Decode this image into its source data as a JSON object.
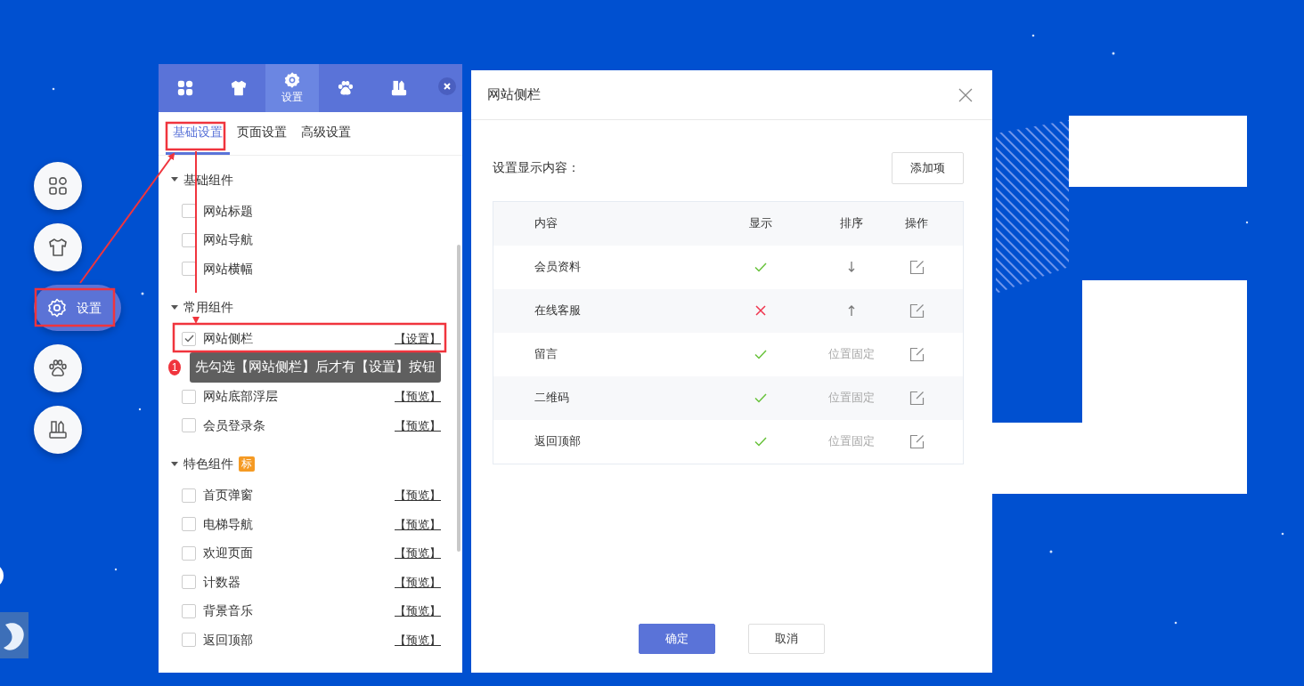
{
  "side_nav": [
    {
      "selected": false
    },
    {
      "selected": false
    },
    {
      "label": "设置",
      "selected": true
    },
    {
      "selected": false
    },
    {
      "selected": false
    }
  ],
  "panel": {
    "tabs": [
      {
        "selected": false
      },
      {
        "selected": false
      },
      {
        "label": "设置",
        "selected": true
      },
      {
        "selected": false
      },
      {
        "selected": false
      }
    ],
    "subtabs": [
      {
        "label": "基础设置",
        "selected": true
      },
      {
        "label": "页面设置",
        "selected": false
      },
      {
        "label": "高级设置",
        "selected": false
      }
    ],
    "groups": [
      {
        "title": "基础组件",
        "expanded": true,
        "items": [
          {
            "label": "网站标题",
            "checked": false
          },
          {
            "label": "网站导航",
            "checked": false
          },
          {
            "label": "网站横幅",
            "checked": false
          }
        ]
      },
      {
        "title": "常用组件",
        "expanded": true,
        "items": [
          {
            "kind": "item",
            "label": "网站侧栏",
            "checked": true,
            "action": "【设置】"
          },
          {
            "kind": "covered"
          },
          {
            "kind": "item",
            "label": "网站底部浮层",
            "checked": false,
            "action": "【预览】"
          },
          {
            "kind": "item",
            "label": "会员登录条",
            "checked": false,
            "action": "【预览】"
          }
        ]
      },
      {
        "title": "特色组件",
        "badge": "标",
        "expanded": true,
        "items": [
          {
            "label": "首页弹窗",
            "checked": false,
            "action": "【预览】"
          },
          {
            "label": "电梯导航",
            "checked": false,
            "action": "【预览】"
          },
          {
            "label": "欢迎页面",
            "checked": false,
            "action": "【预览】"
          },
          {
            "label": "计数器",
            "checked": false,
            "action": "【预览】"
          },
          {
            "label": "背景音乐",
            "checked": false,
            "action": "【预览】"
          },
          {
            "label": "返回顶部",
            "checked": false,
            "action": "【预览】"
          }
        ]
      }
    ]
  },
  "tooltip": {
    "number": "1",
    "text": "先勾选【网站侧栏】后才有【设置】按钮"
  },
  "dialog": {
    "title": "网站侧栏",
    "label": "设置显示内容：",
    "add_button": "添加项",
    "columns": [
      "内容",
      "显示",
      "排序",
      "操作"
    ],
    "rows": [
      {
        "name": "会员资料",
        "shown": true,
        "kind": "down"
      },
      {
        "name": "在线客服",
        "shown": false,
        "kind": "up"
      },
      {
        "name": "留言",
        "shown": true,
        "kind": "fixed",
        "order_text": "位置固定"
      },
      {
        "name": "二维码",
        "shown": true,
        "kind": "fixed",
        "order_text": "位置固定"
      },
      {
        "name": "返回顶部",
        "shown": true,
        "kind": "fixed",
        "order_text": "位置固定"
      }
    ],
    "buttons": [
      {
        "label": "确定",
        "kind": "primary"
      },
      {
        "label": "取消",
        "kind": "secondary"
      }
    ]
  }
}
